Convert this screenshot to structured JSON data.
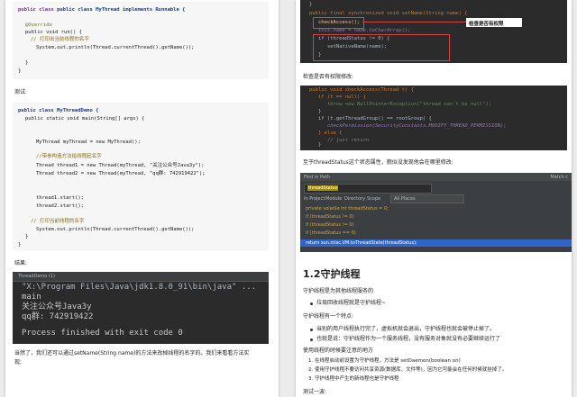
{
  "left": {
    "code1": [
      "public class MyThread implements Runnable {",
      "@Override",
      "public void run() {",
      "// 打印出当前线程的名字",
      "System.out.println(Thread.currentThread().getName());",
      "}",
      "}"
    ],
    "label_test": "测试:",
    "code2": [
      "public class MyThreadDemo {",
      "public static void main(String[] args) {",
      "MyThread myThread = new MyThread();",
      "//带参构造方法给线程起名字",
      "Thread thread1 = new Thread(myThread, \"关注公众号Java3y\");",
      "Thread thread2 = new Thread(myThread, \"qq群: 742919422\");",
      "thread1.start();",
      "thread2.start();",
      "// 打印当前线程的名字",
      "System.out.println(Thread.currentThread().getName());",
      "}",
      "}"
    ],
    "label_result": "结果:",
    "console": {
      "title": "ThreadDemo (1)",
      "lines": [
        "\"X:\\Program Files\\Java\\jdk1.8.0_91\\bin\\java\" ...",
        "main",
        "关注公众号Java3y",
        "qq群: 742919422",
        "",
        "Process finished with exit code 0"
      ]
    },
    "para_bottom": [
      "当然了，我们还可以通过setName(String name)的方法来改掉线程的名字的。我们来看看方法实",
      "现;"
    ]
  },
  "right": {
    "ide_top": [
      "}",
      "public final synchronized void setName(String name) {",
      "checkAccess();",
      "this.name = name.toCharArray();",
      "if (threadStatus != 0) {",
      "setNativeName(name);",
      "}",
      "}"
    ],
    "callout": "检查是否有权限",
    "label_check": "检查是否有权限修改:",
    "ide_mid": [
      "public void checkAccess(Thread t) {",
      "if (t == null) {",
      "throw new NullPointerException(\"thread can't be null\");",
      "}",
      "if (t.getThreadGroup() == rootGroup) {",
      "checkPermission(SecurityConstants.MODIFY_THREAD_PERMISSION);",
      "} else {",
      "// just return",
      "}",
      "}"
    ],
    "label_status": "至于threadStatus这个状态属性，貌似没发现他会在哪里修改:",
    "find": {
      "title": "Find in Path",
      "match_case": "Match c",
      "query": "threadStatus",
      "options": [
        "In Project",
        "Module",
        "Directory",
        "Scope"
      ],
      "scope_value": "All Places",
      "results": [
        "private volatile int threadStatus = 0;",
        "if (threadStatus != 0)",
        "if (threadStatus != 0)",
        "if (threadStatus == 0)",
        "return sun.misc.VM.toThreadState(threadStatus);"
      ]
    },
    "heading": "1.2守护线程",
    "p1": "守护线程是为其他线程服务的",
    "b1": "垃圾回收线程就是守护线程~",
    "p2": "守护线程有一个特点:",
    "b2": "当别的用户线程执行完了，虚拟机就会退出，守护线程也就会被停止掉了。",
    "b3": "也就是说：守护线程作为一个服务线程，没有服务对象就没有必要继续运行了",
    "p3": "使用线程的时候要注意的地方",
    "n1": "1. 在线程启动前设置为守护线程，方法是 setDaemon(boolean on)",
    "n2": "2. 使用守护线程不要访问共享资源(数据库、文件等)，因为它可能会在任何时候就挂掉了。",
    "n3": "3. 守护线程中产生的新线程也是守护线程",
    "p4": "测试一波:"
  }
}
